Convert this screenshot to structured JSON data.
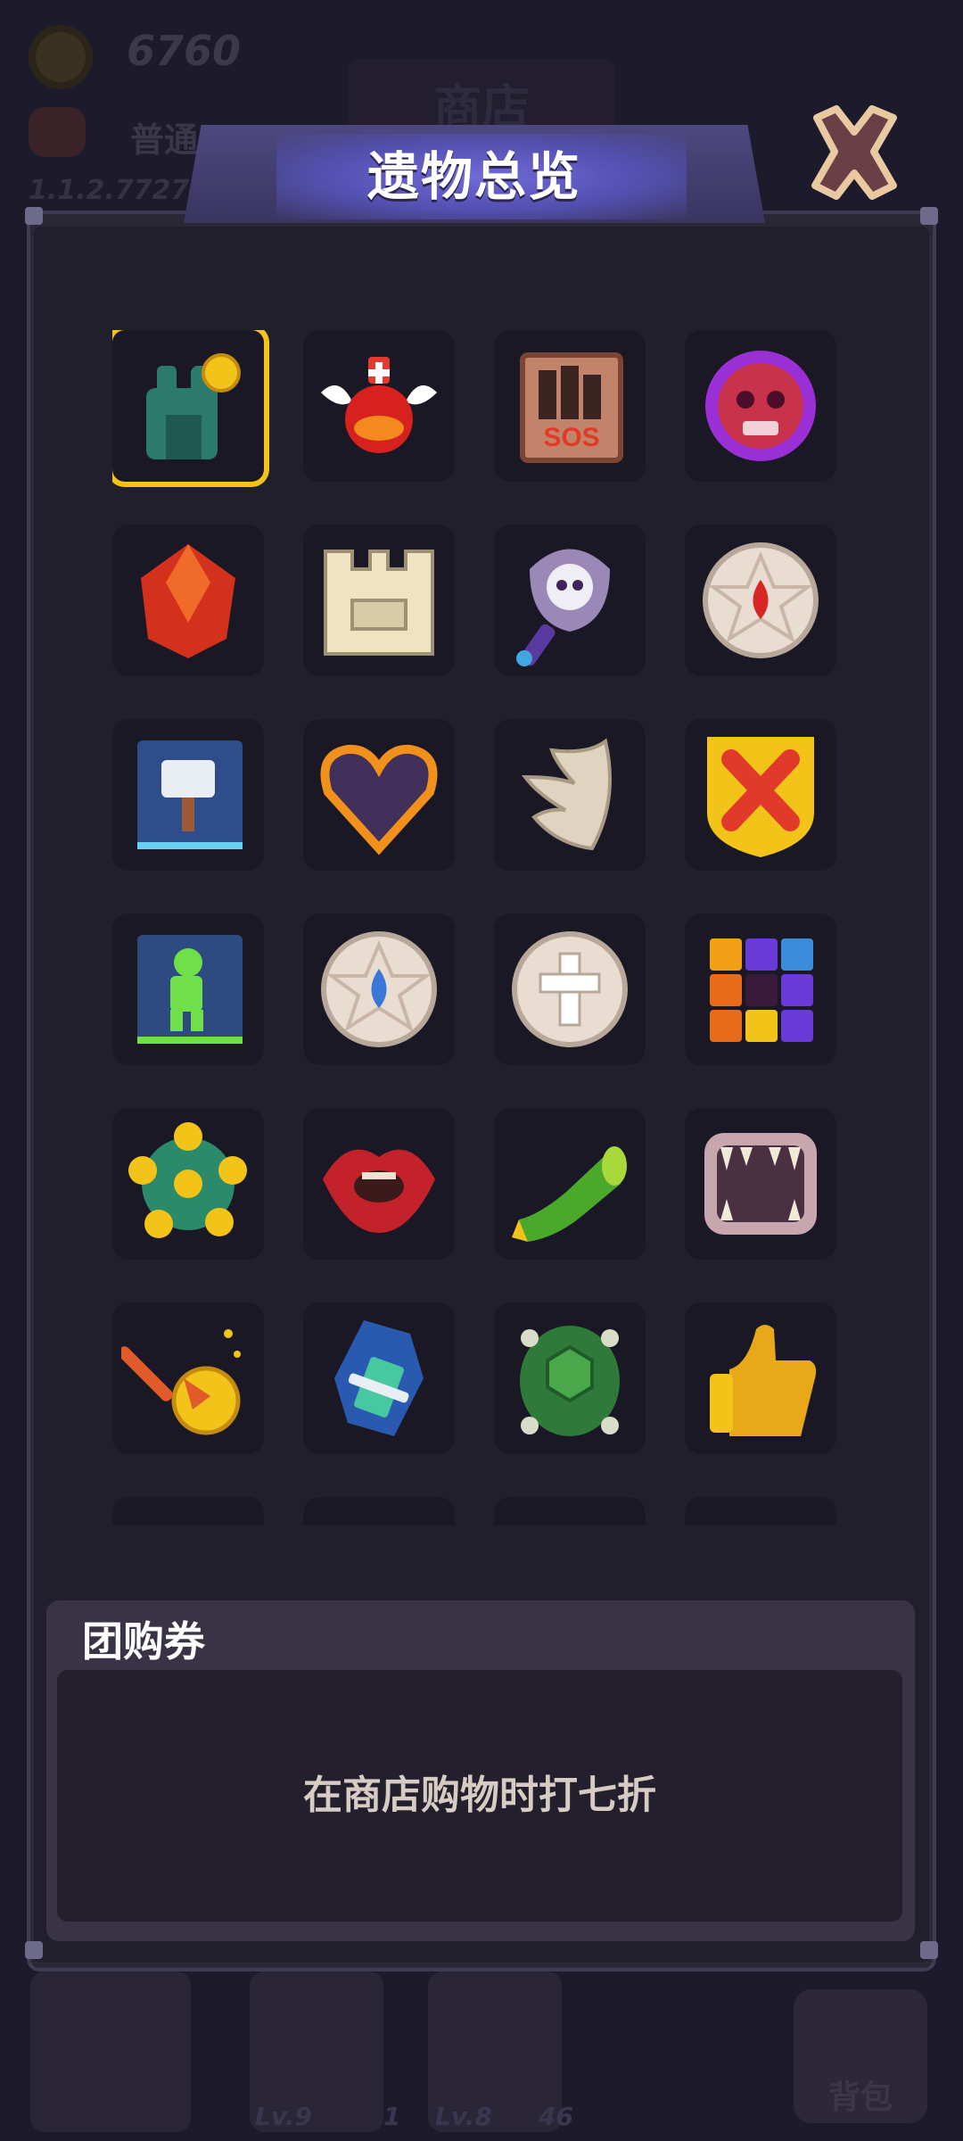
{
  "background": {
    "gold_amount": "6760",
    "rank_label": "普通",
    "version_text": "1.1.2.7727",
    "shop_label": "商店",
    "bag_label": "背包",
    "characters": [
      {
        "level": "Lv.9",
        "count": "1"
      },
      {
        "level": "Lv.8",
        "count": "46"
      }
    ]
  },
  "modal": {
    "title": "遗物总览",
    "close_icon": "close-x-icon"
  },
  "relics": [
    {
      "name": "green-tower-coin-icon",
      "selected": true
    },
    {
      "name": "health-potion-wings-icon"
    },
    {
      "name": "sos-book-icon"
    },
    {
      "name": "purple-skull-orb-icon"
    },
    {
      "name": "red-crystal-icon"
    },
    {
      "name": "stone-castle-wall-icon"
    },
    {
      "name": "skull-battle-axe-icon"
    },
    {
      "name": "blood-pentagram-medal-icon"
    },
    {
      "name": "hammer-book-icon"
    },
    {
      "name": "empty-heart-icon"
    },
    {
      "name": "angel-wing-icon"
    },
    {
      "name": "red-x-shield-icon"
    },
    {
      "name": "soldier-book-icon"
    },
    {
      "name": "water-pentagram-medal-icon"
    },
    {
      "name": "cross-medal-icon"
    },
    {
      "name": "color-grid-icon"
    },
    {
      "name": "golden-spiked-orb-icon"
    },
    {
      "name": "red-lips-icon"
    },
    {
      "name": "green-horn-icon"
    },
    {
      "name": "fanged-mouth-icon"
    },
    {
      "name": "arrow-gold-coin-icon"
    },
    {
      "name": "blue-coffin-icon"
    },
    {
      "name": "turtle-shell-icon"
    },
    {
      "name": "thumbs-up-icon"
    },
    {
      "name": "partial-relic-icon-25"
    },
    {
      "name": "partial-relic-icon-26"
    },
    {
      "name": "partial-relic-icon-27"
    },
    {
      "name": "partial-relic-icon-28"
    }
  ],
  "description": {
    "title": "团购券",
    "text": "在商店购物时打七折"
  },
  "colors": {
    "selection": "#f4c21a",
    "panel": "#3a3346",
    "slot": "#1b1826"
  }
}
